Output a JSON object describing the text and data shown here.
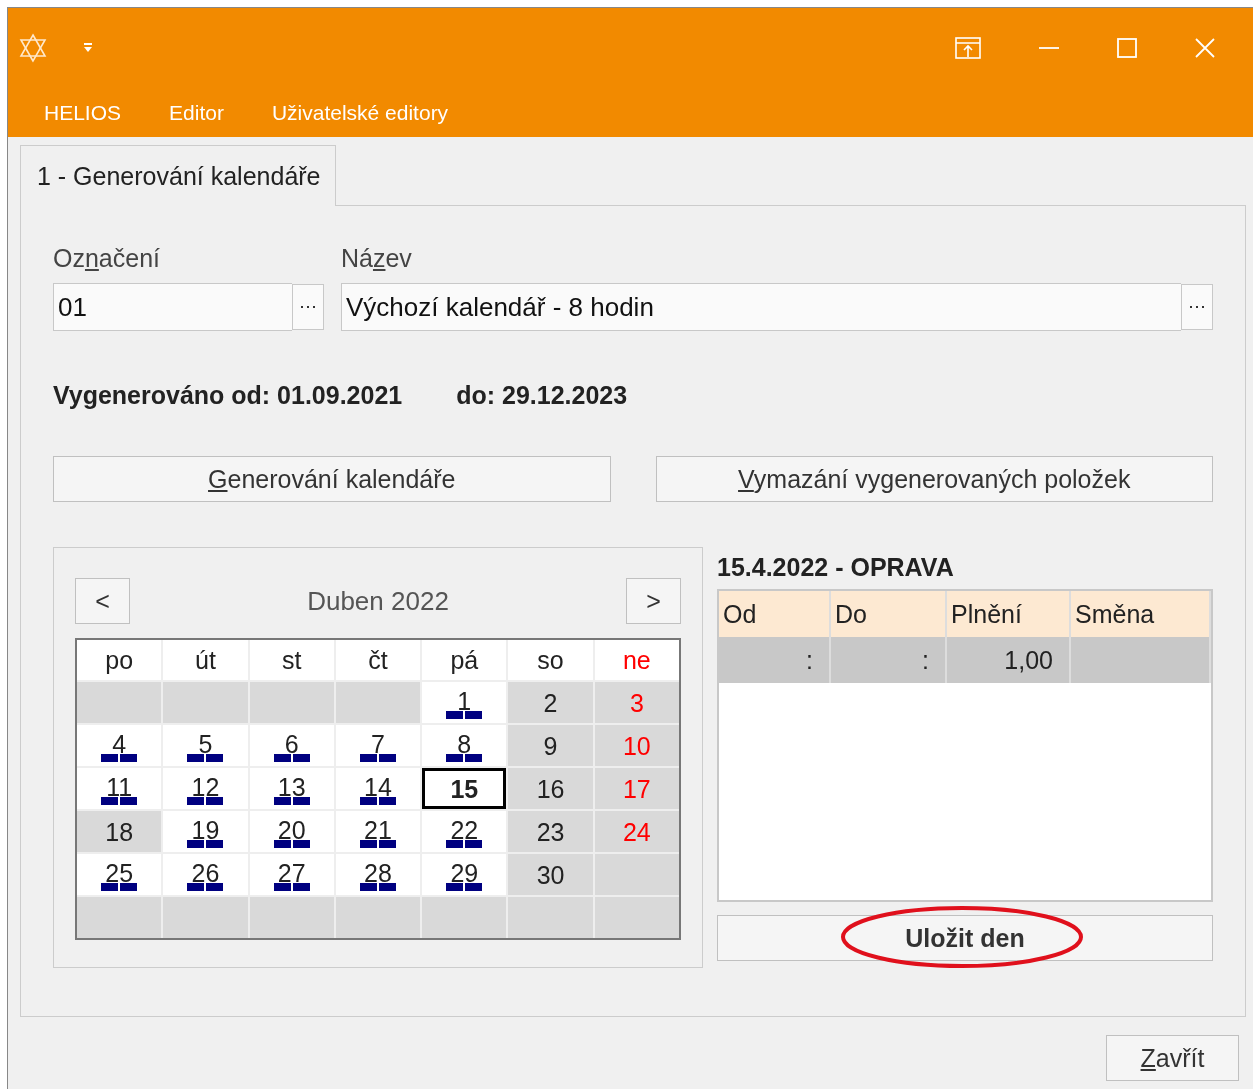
{
  "window": {
    "menu": [
      {
        "label": "HELIOS"
      },
      {
        "label": "Editor"
      },
      {
        "label": "Uživatelské editory"
      }
    ]
  },
  "tabs": [
    {
      "label": "1 - Generování kalendáře",
      "selected": true
    }
  ],
  "fields": [
    {
      "label_before": "Oz",
      "access_key": "n",
      "label_after": "ačení",
      "value": "01"
    },
    {
      "label_before": "Ná",
      "access_key": "z",
      "label_after": "ev",
      "value": "Výchozí kalendář - 8 hodin"
    }
  ],
  "generated": {
    "from": "Vygenerováno od: 01.09.2021",
    "to": "do: 29.12.2023"
  },
  "actions": [
    {
      "access_key": "G",
      "label_after": "enerování kalendáře"
    },
    {
      "access_key": "V",
      "label_after": "ymazání vygenerovaných položek"
    }
  ],
  "calendar": {
    "prev": "<",
    "next": ">",
    "month": "Duben 2022",
    "weekdays": [
      {
        "label": "po",
        "sunday": false
      },
      {
        "label": "út",
        "sunday": false
      },
      {
        "label": "st",
        "sunday": false
      },
      {
        "label": "čt",
        "sunday": false
      },
      {
        "label": "pá",
        "sunday": false
      },
      {
        "label": "so",
        "sunday": false
      },
      {
        "label": "ne",
        "sunday": true
      }
    ],
    "days": [
      {
        "kind": "empty"
      },
      {
        "kind": "empty"
      },
      {
        "kind": "empty"
      },
      {
        "kind": "empty"
      },
      {
        "kind": "day",
        "day": "1",
        "workday": true,
        "sunday": false,
        "selected": false
      },
      {
        "kind": "day",
        "day": "2",
        "workday": false,
        "sunday": false,
        "selected": false
      },
      {
        "kind": "day",
        "day": "3",
        "workday": false,
        "sunday": true,
        "selected": false
      },
      {
        "kind": "day",
        "day": "4",
        "workday": true,
        "sunday": false,
        "selected": false
      },
      {
        "kind": "day",
        "day": "5",
        "workday": true,
        "sunday": false,
        "selected": false
      },
      {
        "kind": "day",
        "day": "6",
        "workday": true,
        "sunday": false,
        "selected": false
      },
      {
        "kind": "day",
        "day": "7",
        "workday": true,
        "sunday": false,
        "selected": false
      },
      {
        "kind": "day",
        "day": "8",
        "workday": true,
        "sunday": false,
        "selected": false
      },
      {
        "kind": "day",
        "day": "9",
        "workday": false,
        "sunday": false,
        "selected": false
      },
      {
        "kind": "day",
        "day": "10",
        "workday": false,
        "sunday": true,
        "selected": false
      },
      {
        "kind": "day",
        "day": "11",
        "workday": true,
        "sunday": false,
        "selected": false
      },
      {
        "kind": "day",
        "day": "12",
        "workday": true,
        "sunday": false,
        "selected": false
      },
      {
        "kind": "day",
        "day": "13",
        "workday": true,
        "sunday": false,
        "selected": false
      },
      {
        "kind": "day",
        "day": "14",
        "workday": true,
        "sunday": false,
        "selected": false
      },
      {
        "kind": "day",
        "day": "15",
        "workday": true,
        "sunday": false,
        "selected": true
      },
      {
        "kind": "day",
        "day": "16",
        "workday": false,
        "sunday": false,
        "selected": false
      },
      {
        "kind": "day",
        "day": "17",
        "workday": false,
        "sunday": true,
        "selected": false
      },
      {
        "kind": "day",
        "day": "18",
        "workday": false,
        "sunday": false,
        "selected": false
      },
      {
        "kind": "day",
        "day": "19",
        "workday": true,
        "sunday": false,
        "selected": false
      },
      {
        "kind": "day",
        "day": "20",
        "workday": true,
        "sunday": false,
        "selected": false
      },
      {
        "kind": "day",
        "day": "21",
        "workday": true,
        "sunday": false,
        "selected": false
      },
      {
        "kind": "day",
        "day": "22",
        "workday": true,
        "sunday": false,
        "selected": false
      },
      {
        "kind": "day",
        "day": "23",
        "workday": false,
        "sunday": false,
        "selected": false
      },
      {
        "kind": "day",
        "day": "24",
        "workday": false,
        "sunday": true,
        "selected": false
      },
      {
        "kind": "day",
        "day": "25",
        "workday": true,
        "sunday": false,
        "selected": false
      },
      {
        "kind": "day",
        "day": "26",
        "workday": true,
        "sunday": false,
        "selected": false
      },
      {
        "kind": "day",
        "day": "27",
        "workday": true,
        "sunday": false,
        "selected": false
      },
      {
        "kind": "day",
        "day": "28",
        "workday": true,
        "sunday": false,
        "selected": false
      },
      {
        "kind": "day",
        "day": "29",
        "workday": true,
        "sunday": false,
        "selected": false
      },
      {
        "kind": "day",
        "day": "30",
        "workday": false,
        "sunday": false,
        "selected": false
      },
      {
        "kind": "empty"
      },
      {
        "kind": "empty"
      },
      {
        "kind": "empty"
      },
      {
        "kind": "empty"
      },
      {
        "kind": "empty"
      },
      {
        "kind": "empty"
      },
      {
        "kind": "empty"
      },
      {
        "kind": "empty"
      }
    ]
  },
  "day_detail": {
    "title": "15.4.2022 - OPRAVA",
    "columns": [
      "Od",
      "Do",
      "Plnění",
      "Směna"
    ],
    "rows": [
      {
        "od": ":",
        "do": ":",
        "plneni": "1,00",
        "selected": true
      }
    ]
  },
  "save_button": {
    "label": "Uložit den",
    "circled": true
  },
  "close_button": {
    "access_key": "Z",
    "label_after": "avřít"
  }
}
